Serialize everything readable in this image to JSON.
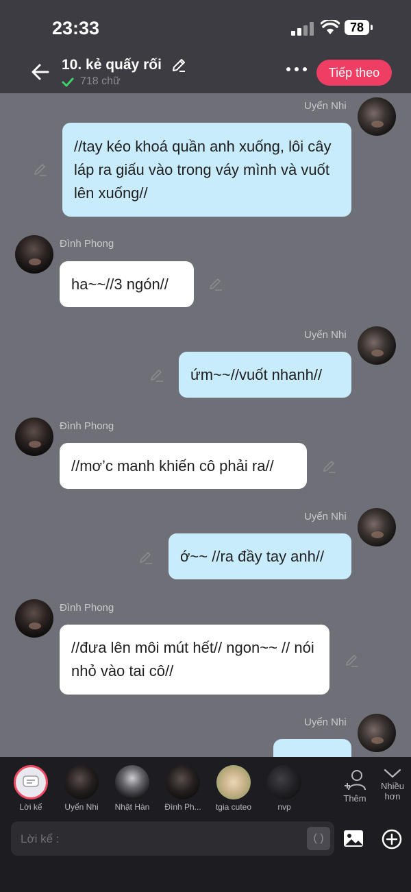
{
  "status_bar": {
    "time": "23:33",
    "battery": "78"
  },
  "header": {
    "title": "10. kẻ quấy rối",
    "word_count": "718 chữ",
    "next_label": "Tiếp theo"
  },
  "messages": [
    {
      "sender": "Uyển Nhi",
      "text": "//tay kéo khoá quần anh xuống, lôi cây láp ra giấu vào trong váy mình và vuốt lên xuống//"
    },
    {
      "sender": "Đình Phong",
      "text": "ha~~//3 ngón//"
    },
    {
      "sender": "Uyển Nhi",
      "text": "ứm~~//vuốt nhanh//"
    },
    {
      "sender": "Đình Phong",
      "text": "//mơ’c manh khiến cô phải ra//"
    },
    {
      "sender": "Uyển Nhi",
      "text": "ớ~~ //ra đầy tay anh//"
    },
    {
      "sender": "Đình Phong",
      "text": "//đưa lên môi mút hết// ngon~~ // nói nhỏ vào tai cô//"
    },
    {
      "sender": "Uyển Nhi",
      "text": ""
    }
  ],
  "characters": [
    {
      "label": "Lời kể"
    },
    {
      "label": "Uyển Nhi"
    },
    {
      "label": "Nhật Hàn"
    },
    {
      "label": "Đình Ph..."
    },
    {
      "label": "tgia cuteo"
    },
    {
      "label": "nvp"
    }
  ],
  "add_label": "Thêm",
  "more_label_1": "Nhiều",
  "more_label_2": "hơn",
  "input": {
    "placeholder": "Lời kể :",
    "paren": "( )"
  }
}
